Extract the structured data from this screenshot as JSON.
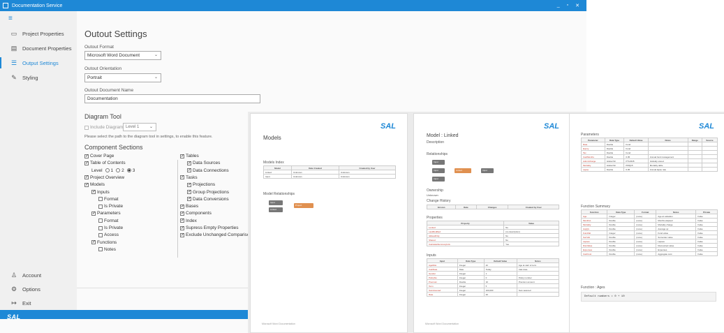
{
  "window": {
    "title": "Documentation Service",
    "min": "_",
    "max": "▫",
    "close": "✕"
  },
  "nav": [
    {
      "label": "Project Properties",
      "icon": "▭"
    },
    {
      "label": "Document Properties",
      "icon": "▤"
    },
    {
      "label": "Output Settings",
      "icon": "☰"
    },
    {
      "label": "Styling",
      "icon": "✎"
    }
  ],
  "nav_bottom": [
    {
      "label": "Account",
      "icon": "♙"
    },
    {
      "label": "Options",
      "icon": "⚙"
    },
    {
      "label": "Exit",
      "icon": "↦"
    }
  ],
  "status": {
    "logo": "SAL"
  },
  "settings": {
    "title": "Outout Settings",
    "format_label": "Outout Format",
    "format_value": "Microsoft Word Document",
    "orientation_label": "Outout Orientation",
    "orientation_value": "Portrait",
    "docname_label": "Outout Document Name",
    "docname_value": "Documentation"
  },
  "diagram": {
    "title": "Diagram Tool",
    "include_label": "Include Diagrams",
    "level_value": "Level 1",
    "note": "Please select the path to the diagram tool in settings, to enable this feature."
  },
  "components": {
    "title": "Component Sections",
    "level_label": "Level",
    "level_options": [
      "1",
      "2",
      "3"
    ],
    "left": [
      {
        "label": "Cover Page",
        "checked": true,
        "indent": 0
      },
      {
        "label": "Table of Contents",
        "checked": true,
        "indent": 0
      },
      {
        "label": "Project Overview",
        "checked": true,
        "indent": 0
      },
      {
        "label": "Models",
        "checked": true,
        "indent": 0
      },
      {
        "label": "Inputs",
        "checked": true,
        "indent": 1
      },
      {
        "label": "Format",
        "checked": false,
        "indent": 2
      },
      {
        "label": "Is Private",
        "checked": false,
        "indent": 2
      },
      {
        "label": "Parameters",
        "checked": true,
        "indent": 1
      },
      {
        "label": "Format",
        "checked": false,
        "indent": 2
      },
      {
        "label": "Is Private",
        "checked": false,
        "indent": 2
      },
      {
        "label": "Access",
        "checked": false,
        "indent": 2
      },
      {
        "label": "Functions",
        "checked": true,
        "indent": 1
      },
      {
        "label": "Notes",
        "checked": false,
        "indent": 2
      }
    ],
    "right": [
      {
        "label": "Tables",
        "checked": true,
        "indent": 0
      },
      {
        "label": "Data Sources",
        "checked": true,
        "indent": 1
      },
      {
        "label": "Data Connections",
        "checked": true,
        "indent": 1
      },
      {
        "label": "Tasks",
        "checked": true,
        "indent": 0
      },
      {
        "label": "Projections",
        "checked": true,
        "indent": 1
      },
      {
        "label": "Group Projections",
        "checked": true,
        "indent": 1
      },
      {
        "label": "Data Conversions",
        "checked": true,
        "indent": 1
      },
      {
        "label": "Bases",
        "checked": true,
        "indent": 0
      },
      {
        "label": "Components",
        "checked": true,
        "indent": 0
      },
      {
        "label": "Index",
        "checked": true,
        "indent": 0
      },
      {
        "label": "Supress Empty Properties",
        "checked": true,
        "indent": 0
      },
      {
        "label": "Exclude Unchanged Comparisor",
        "checked": true,
        "indent": 0
      }
    ]
  },
  "preview": {
    "page1": {
      "logo": "SAL",
      "title": "Models",
      "index_title": "Models Index",
      "index_headers": [
        "Model",
        "Date Created",
        "Created by User"
      ],
      "index_rows": [
        [
          "Linked",
          "Unknown",
          "Unknown"
        ],
        [
          "Input",
          "Unknown",
          "Unknown"
        ]
      ],
      "rel_title": "Model Relationships",
      "node_a": "Input",
      "node_b": "Linked",
      "node_c": "Project"
    },
    "page2": {
      "logo": "SAL",
      "title": "Model : Linked",
      "desc": "Description",
      "rel": "Relationships",
      "node_a": "Input",
      "node_b": "Linked",
      "ownership": "Ownership",
      "owner": "Unknown",
      "history": "Change History",
      "history_headers": [
        "Version",
        "Date",
        "Changes",
        "Created by User"
      ],
      "properties": "Properties",
      "prop_headers": [
        "Property",
        "Value"
      ],
      "prop_rows": [
        [
          "Locked",
          "No"
        ],
        [
          "LastModified",
          "(no description)"
        ],
        [
          "IsReadOnly",
          "No"
        ],
        [
          "Shared",
          "No"
        ],
        [
          "CalculateSummaryLink",
          "Yes"
        ]
      ],
      "inputs": "Inputs",
      "input_headers": [
        "Input",
        "Data Type",
        "Default Value",
        "Notes"
      ],
      "input_rows": [
        [
          "AgeRisk",
          "Integer",
          "42",
          "Age at start of term"
        ],
        [
          "CalcDate",
          "Date",
          "Today",
          "Calc date"
        ],
        [
          "Gender",
          "Integer",
          "1",
          ""
        ],
        [
          "PolicyNo",
          "Integer",
          "0",
          "Policy number"
        ],
        [
          "Premium",
          "Double",
          "10",
          "Premium amount"
        ],
        [
          "Term",
          "Integer",
          "5",
          ""
        ],
        [
          "SumAssured",
          "Integer",
          "100,000",
          "Sum assured"
        ],
        [
          "Rate",
          "Integer",
          "20",
          ""
        ]
      ]
    },
    "page3": {
      "logo": "SAL",
      "params": "Parameters",
      "param_headers": [
        "Parameter",
        "Data Type",
        "Default Value",
        "Notes",
        "Range",
        "Source"
      ],
      "param_rows": [
        [
          "Rate",
          "Double",
          "Fund",
          "",
          "",
          ""
        ],
        [
          "Expiry",
          "Double",
          "Fund",
          "",
          "",
          ""
        ],
        [
          "Tax",
          "Double",
          "Fund",
          "",
          "",
          ""
        ],
        [
          "CalcMonths",
          "Double",
          "0.05",
          "Annual fund management",
          "",
          ""
        ],
        [
          "AdminCharge",
          "Global Str",
          "PT12345",
          "Globally stored",
          "",
          ""
        ],
        [
          "Mortality",
          "Global Str",
          "PMQ15",
          "Mortality table",
          "",
          ""
        ],
        [
          "Lapse",
          "Double",
          "0.05",
          "Annual lapse rate",
          "",
          ""
        ]
      ],
      "funcs": "Function Summary",
      "func_headers": [
        "Function",
        "Data Type",
        "Format",
        "Notes",
        "Private"
      ],
      "func_rows": [
        [
          "Age",
          "Integer",
          "(none)",
          "Age at valuation",
          "False"
        ],
        [
          "MonthsL",
          "Double",
          "(none)",
          "Months elapsed",
          "False"
        ],
        [
          "Mortality",
          "Double",
          "(none)",
          "Mortality charge",
          "False"
        ],
        [
          "AvgQx",
          "Double",
          "(none)",
          "Average qx",
          "False"
        ],
        [
          "FundVal",
          "Integer",
          "(none)",
          "Fund value",
          "False"
        ],
        [
          "SurrVal",
          "Double",
          "(none)",
          "Surrender value",
          "False"
        ],
        [
          "Lapses",
          "Double",
          "(none)",
          "Lapses",
          "False"
        ],
        [
          "DiscValue",
          "Double",
          "(none)",
          "Discounted value",
          "False"
        ],
        [
          "Expenses",
          "Double",
          "(none)",
          "Expenses",
          "False"
        ],
        [
          "CalcCost",
          "Double",
          "(none)",
          "Aggregate cost",
          "False"
        ]
      ],
      "age_title": "Function : Ages",
      "age_code": "Default numbers = 0 + 10"
    }
  }
}
